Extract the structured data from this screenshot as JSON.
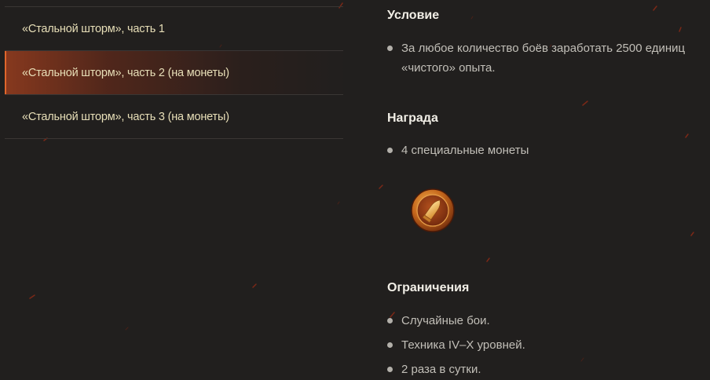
{
  "missions": [
    {
      "label": "«Стальной шторм», часть 1",
      "active": false
    },
    {
      "label": "«Стальной шторм», часть 2 (на монеты)",
      "active": true
    },
    {
      "label": "«Стальной шторм», часть 3 (на монеты)",
      "active": false
    }
  ],
  "condition": {
    "title": "Условие",
    "items": [
      "За любое количество боёв заработать 2500 единиц «чистого» опыта."
    ]
  },
  "reward": {
    "title": "Награда",
    "items": [
      "4 специальные монеты"
    ],
    "icon": "bullet-coin-icon"
  },
  "restrictions": {
    "title": "Ограничения",
    "items": [
      "Случайные бои.",
      "Техника IV–X уровней.",
      "2 раза в сутки."
    ]
  },
  "colors": {
    "background": "#211f1e",
    "accent": "#e0662c",
    "mission_label": "#e8dfb8",
    "heading": "#f1eee6",
    "body_text": "#c2bfb8"
  }
}
